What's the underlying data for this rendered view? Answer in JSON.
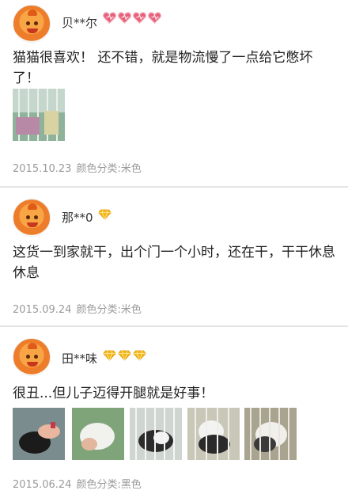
{
  "reviews": [
    {
      "username": "贝**尔",
      "level_icon": "heart-icon",
      "level_count": 4,
      "content": "猫猫很喜欢！ 还不错，就是物流慢了一点给它憋坏了！",
      "date": "2015.10.23",
      "variant_label": "颜色分类:",
      "variant_value": "米色",
      "photo_count": 1
    },
    {
      "username": "那**0",
      "level_icon": "diamond-icon",
      "level_count": 1,
      "content": "这货一到家就干，出个门一个小时，还在干，干干休息休息",
      "date": "2015.09.24",
      "variant_label": "颜色分类:",
      "variant_value": "米色",
      "photo_count": 0
    },
    {
      "username": "田**味",
      "level_icon": "diamond-icon",
      "level_count": 3,
      "content": "很丑...但儿子迈得开腿就是好事！",
      "date": "2015.06.24",
      "variant_label": "颜色分类:",
      "variant_value": "黑色",
      "photo_count": 5
    }
  ],
  "colors": {
    "heart": "#e8607a",
    "diamond": "#f5b81c",
    "meta_text": "#9a9a9a",
    "divider": "#e5e5e5"
  }
}
